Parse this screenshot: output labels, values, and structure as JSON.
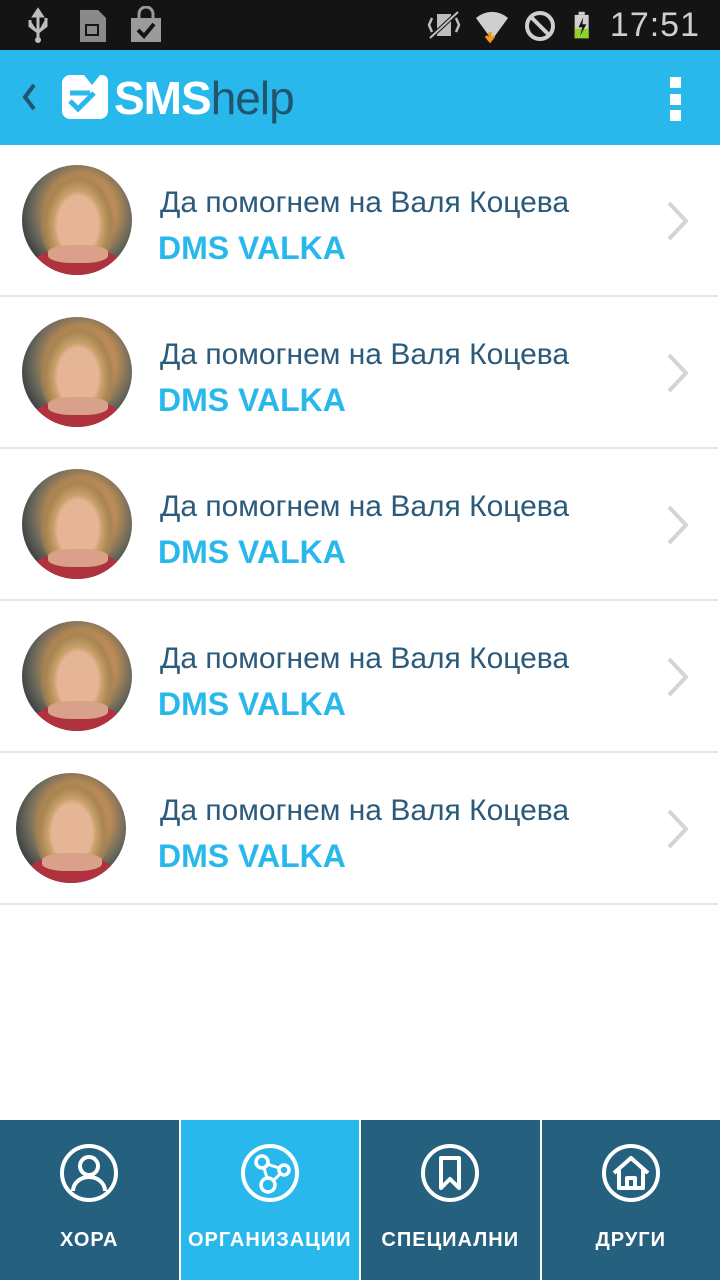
{
  "status_bar": {
    "time": "17:51",
    "icons": [
      "usb-icon",
      "sd-card-icon",
      "shopping-bag-check-icon",
      "vibrate-icon",
      "wifi-icon",
      "do-not-disturb-icon",
      "battery-charging-icon"
    ]
  },
  "app_bar": {
    "logo_sms": "SMS",
    "logo_help": "help",
    "icons": [
      "back-chevron-icon",
      "logo-icon",
      "overflow-menu-icon"
    ]
  },
  "list": {
    "items": [
      {
        "title": "Да помогнем на Валя Коцева",
        "subtitle": "DMS VALKA"
      },
      {
        "title": "Да помогнем на Валя Коцева",
        "subtitle": "DMS VALKA"
      },
      {
        "title": "Да помогнем на Валя Коцева",
        "subtitle": "DMS VALKA"
      },
      {
        "title": "Да помогнем на Валя Коцева",
        "subtitle": "DMS VALKA"
      },
      {
        "title": "Да помогнем на Валя Коцева",
        "subtitle": "DMS VALKA"
      }
    ]
  },
  "bottom_nav": {
    "tabs": [
      {
        "label": "ХОРА",
        "icon": "person-icon",
        "active": false
      },
      {
        "label": "ОРГАНИЗАЦИИ",
        "icon": "network-icon",
        "active": true
      },
      {
        "label": "СПЕЦИАЛНИ",
        "icon": "bookmark-icon",
        "active": false
      },
      {
        "label": "ДРУГИ",
        "icon": "home-icon",
        "active": false
      }
    ]
  },
  "colors": {
    "accent": "#29b8eb",
    "nav_bg": "#25607f",
    "title_text": "#2b5a7a",
    "status_bar": "#141414"
  }
}
